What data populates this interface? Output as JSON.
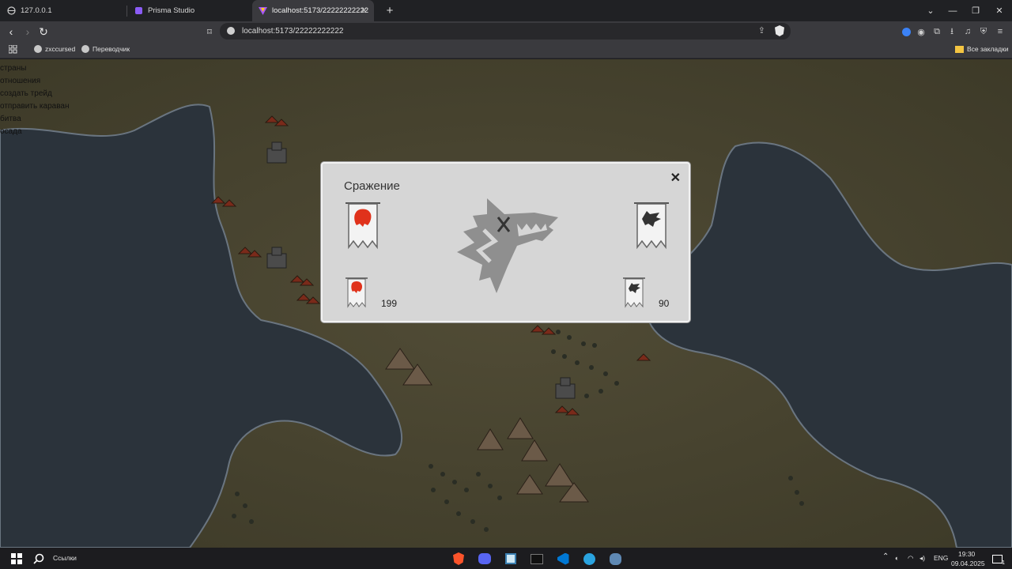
{
  "browser": {
    "tabs": [
      {
        "title": "127.0.0.1",
        "active": false
      },
      {
        "title": "Prisma Studio",
        "active": false
      },
      {
        "title": "localhost:5173/22222222222",
        "active": true
      }
    ],
    "url": "localhost:5173/22222222222",
    "bookmarks": [
      {
        "label": "zxccursed"
      },
      {
        "label": "Переводчик"
      }
    ],
    "all_bookmarks": "Все закладки"
  },
  "menu": {
    "items": [
      "страны",
      "отношения",
      "создать трейд",
      "отправить караван",
      "битва",
      "осада"
    ]
  },
  "battle": {
    "title": "Сражение",
    "close": "✕",
    "left_count": "199",
    "right_count": "90"
  },
  "taskbar": {
    "search": "Ссылки",
    "lang": "ENG",
    "time": "19:30",
    "date": "09.04.2025",
    "notifications": "1"
  },
  "colors": {
    "map_land": "#4a4630",
    "map_water": "#2b333b",
    "lion_red": "#e0321b",
    "wolf_gray": "#8f8f8f"
  }
}
